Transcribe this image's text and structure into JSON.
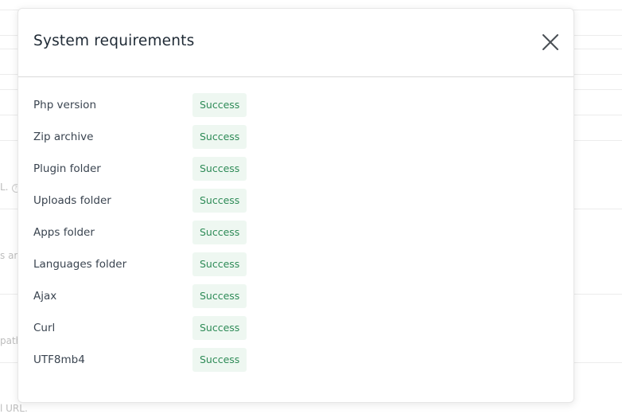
{
  "background": {
    "fragments": [
      "L.",
      "s an",
      "path",
      "l URL."
    ]
  },
  "modal": {
    "title": "System requirements",
    "close_icon": "close-icon",
    "requirements": [
      {
        "label": "Php version",
        "status": "Success"
      },
      {
        "label": "Zip archive",
        "status": "Success"
      },
      {
        "label": "Plugin folder",
        "status": "Success"
      },
      {
        "label": "Uploads folder",
        "status": "Success"
      },
      {
        "label": "Apps folder",
        "status": "Success"
      },
      {
        "label": "Languages folder",
        "status": "Success"
      },
      {
        "label": "Ajax",
        "status": "Success"
      },
      {
        "label": "Curl",
        "status": "Success"
      },
      {
        "label": "UTF8mb4",
        "status": "Success"
      }
    ]
  },
  "colors": {
    "success_text": "#2e8b57",
    "success_bg": "#eef7f1",
    "title": "#1f2a35"
  }
}
